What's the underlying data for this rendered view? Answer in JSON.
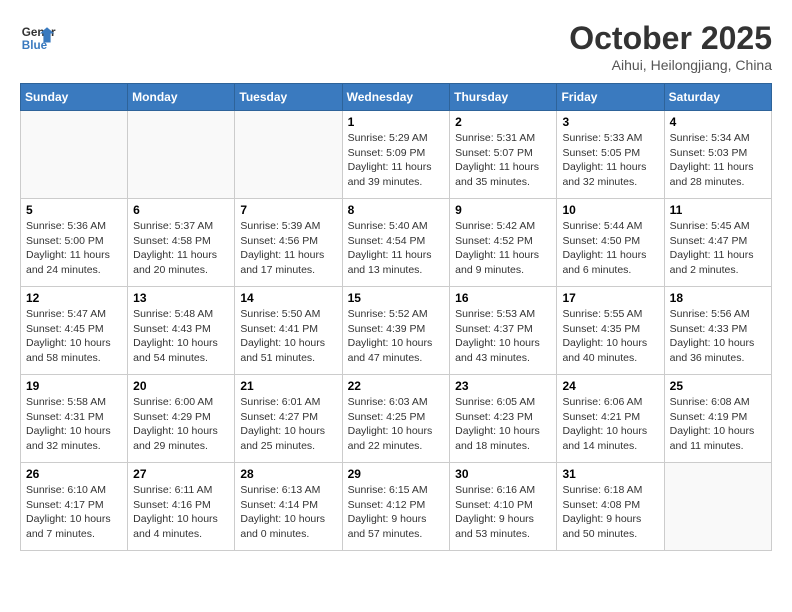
{
  "header": {
    "logo_line1": "General",
    "logo_line2": "Blue",
    "title": "October 2025",
    "subtitle": "Aihui, Heilongjiang, China"
  },
  "weekdays": [
    "Sunday",
    "Monday",
    "Tuesday",
    "Wednesday",
    "Thursday",
    "Friday",
    "Saturday"
  ],
  "weeks": [
    [
      {
        "day": "",
        "info": ""
      },
      {
        "day": "",
        "info": ""
      },
      {
        "day": "",
        "info": ""
      },
      {
        "day": "1",
        "info": "Sunrise: 5:29 AM\nSunset: 5:09 PM\nDaylight: 11 hours\nand 39 minutes."
      },
      {
        "day": "2",
        "info": "Sunrise: 5:31 AM\nSunset: 5:07 PM\nDaylight: 11 hours\nand 35 minutes."
      },
      {
        "day": "3",
        "info": "Sunrise: 5:33 AM\nSunset: 5:05 PM\nDaylight: 11 hours\nand 32 minutes."
      },
      {
        "day": "4",
        "info": "Sunrise: 5:34 AM\nSunset: 5:03 PM\nDaylight: 11 hours\nand 28 minutes."
      }
    ],
    [
      {
        "day": "5",
        "info": "Sunrise: 5:36 AM\nSunset: 5:00 PM\nDaylight: 11 hours\nand 24 minutes."
      },
      {
        "day": "6",
        "info": "Sunrise: 5:37 AM\nSunset: 4:58 PM\nDaylight: 11 hours\nand 20 minutes."
      },
      {
        "day": "7",
        "info": "Sunrise: 5:39 AM\nSunset: 4:56 PM\nDaylight: 11 hours\nand 17 minutes."
      },
      {
        "day": "8",
        "info": "Sunrise: 5:40 AM\nSunset: 4:54 PM\nDaylight: 11 hours\nand 13 minutes."
      },
      {
        "day": "9",
        "info": "Sunrise: 5:42 AM\nSunset: 4:52 PM\nDaylight: 11 hours\nand 9 minutes."
      },
      {
        "day": "10",
        "info": "Sunrise: 5:44 AM\nSunset: 4:50 PM\nDaylight: 11 hours\nand 6 minutes."
      },
      {
        "day": "11",
        "info": "Sunrise: 5:45 AM\nSunset: 4:47 PM\nDaylight: 11 hours\nand 2 minutes."
      }
    ],
    [
      {
        "day": "12",
        "info": "Sunrise: 5:47 AM\nSunset: 4:45 PM\nDaylight: 10 hours\nand 58 minutes."
      },
      {
        "day": "13",
        "info": "Sunrise: 5:48 AM\nSunset: 4:43 PM\nDaylight: 10 hours\nand 54 minutes."
      },
      {
        "day": "14",
        "info": "Sunrise: 5:50 AM\nSunset: 4:41 PM\nDaylight: 10 hours\nand 51 minutes."
      },
      {
        "day": "15",
        "info": "Sunrise: 5:52 AM\nSunset: 4:39 PM\nDaylight: 10 hours\nand 47 minutes."
      },
      {
        "day": "16",
        "info": "Sunrise: 5:53 AM\nSunset: 4:37 PM\nDaylight: 10 hours\nand 43 minutes."
      },
      {
        "day": "17",
        "info": "Sunrise: 5:55 AM\nSunset: 4:35 PM\nDaylight: 10 hours\nand 40 minutes."
      },
      {
        "day": "18",
        "info": "Sunrise: 5:56 AM\nSunset: 4:33 PM\nDaylight: 10 hours\nand 36 minutes."
      }
    ],
    [
      {
        "day": "19",
        "info": "Sunrise: 5:58 AM\nSunset: 4:31 PM\nDaylight: 10 hours\nand 32 minutes."
      },
      {
        "day": "20",
        "info": "Sunrise: 6:00 AM\nSunset: 4:29 PM\nDaylight: 10 hours\nand 29 minutes."
      },
      {
        "day": "21",
        "info": "Sunrise: 6:01 AM\nSunset: 4:27 PM\nDaylight: 10 hours\nand 25 minutes."
      },
      {
        "day": "22",
        "info": "Sunrise: 6:03 AM\nSunset: 4:25 PM\nDaylight: 10 hours\nand 22 minutes."
      },
      {
        "day": "23",
        "info": "Sunrise: 6:05 AM\nSunset: 4:23 PM\nDaylight: 10 hours\nand 18 minutes."
      },
      {
        "day": "24",
        "info": "Sunrise: 6:06 AM\nSunset: 4:21 PM\nDaylight: 10 hours\nand 14 minutes."
      },
      {
        "day": "25",
        "info": "Sunrise: 6:08 AM\nSunset: 4:19 PM\nDaylight: 10 hours\nand 11 minutes."
      }
    ],
    [
      {
        "day": "26",
        "info": "Sunrise: 6:10 AM\nSunset: 4:17 PM\nDaylight: 10 hours\nand 7 minutes."
      },
      {
        "day": "27",
        "info": "Sunrise: 6:11 AM\nSunset: 4:16 PM\nDaylight: 10 hours\nand 4 minutes."
      },
      {
        "day": "28",
        "info": "Sunrise: 6:13 AM\nSunset: 4:14 PM\nDaylight: 10 hours\nand 0 minutes."
      },
      {
        "day": "29",
        "info": "Sunrise: 6:15 AM\nSunset: 4:12 PM\nDaylight: 9 hours\nand 57 minutes."
      },
      {
        "day": "30",
        "info": "Sunrise: 6:16 AM\nSunset: 4:10 PM\nDaylight: 9 hours\nand 53 minutes."
      },
      {
        "day": "31",
        "info": "Sunrise: 6:18 AM\nSunset: 4:08 PM\nDaylight: 9 hours\nand 50 minutes."
      },
      {
        "day": "",
        "info": ""
      }
    ]
  ]
}
